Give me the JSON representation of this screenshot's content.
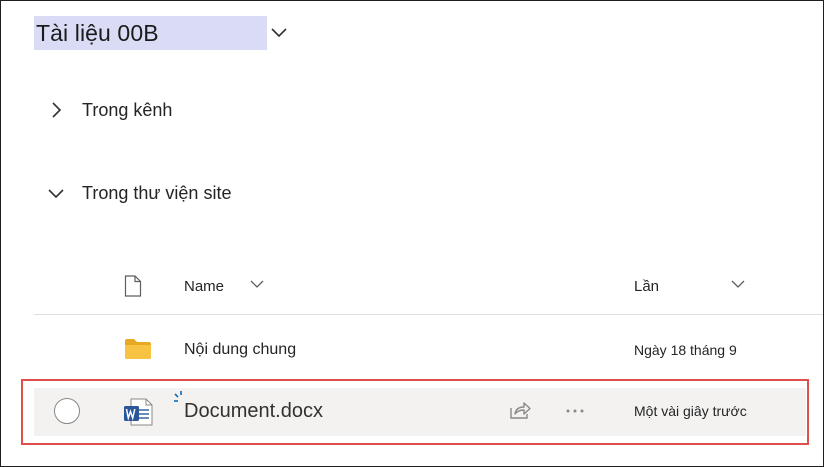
{
  "library": {
    "title": "Tài liệu 00B"
  },
  "sections": {
    "in_channel": "Trong kênh",
    "in_site_library": "Trong thư viện site"
  },
  "columns": {
    "name": "Name",
    "modified": "Lần"
  },
  "rows": [
    {
      "name": "Nội dung chung",
      "modified": "Ngày 18 tháng 9",
      "type": "folder-icon"
    },
    {
      "name": "Document.docx",
      "modified": "Một vài giây trước",
      "type": "word-icon"
    }
  ],
  "colors": {
    "title_highlight": "#d9dcf4",
    "folder": "#f6c342",
    "word": "#2b579a",
    "new_marker": "#0f6cbd",
    "selection_outline": "#e04e4e",
    "row_hover": "#f3f2f1"
  }
}
